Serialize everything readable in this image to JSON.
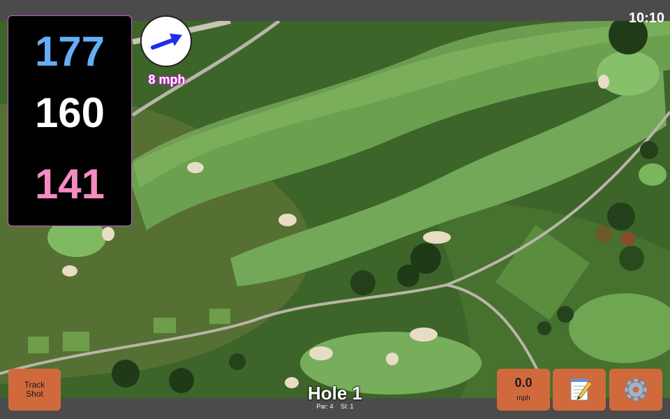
{
  "status_bar": {
    "time": "10:10"
  },
  "distances": {
    "back": "177",
    "middle": "160",
    "front": "141"
  },
  "wind": {
    "speed": "8 mph",
    "direction_icon": "arrow-icon"
  },
  "buttons": {
    "track_shot": {
      "line1": "Track",
      "line2": "Shot"
    },
    "speed": {
      "value": "0.0",
      "unit": "mph"
    },
    "scorecard_icon": "notepad-icon",
    "settings_icon": "gear-icon"
  },
  "hole": {
    "title": "Hole 1",
    "par": "Par: 4",
    "si": "SI: 1"
  },
  "colors": {
    "back": "#64aef5",
    "middle": "#ffffff",
    "front": "#f58bc0",
    "button": "#d06a3d",
    "accent": "#c021c6"
  }
}
